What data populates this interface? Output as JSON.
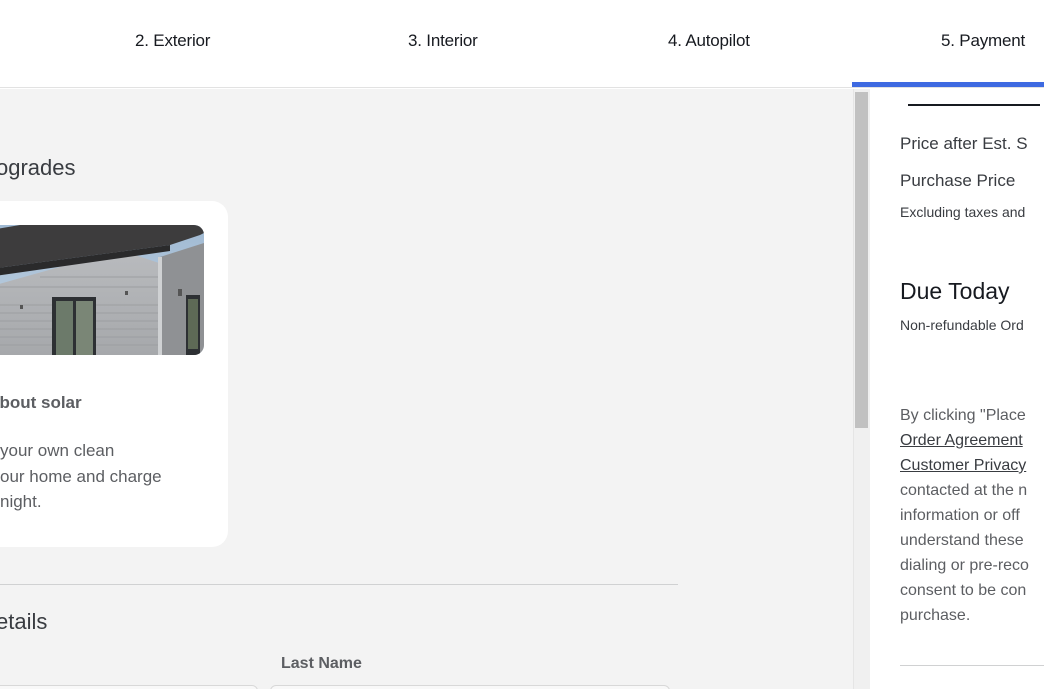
{
  "nav": {
    "steps": [
      {
        "label": "2. Exterior"
      },
      {
        "label": "3. Interior"
      },
      {
        "label": "4. Autopilot"
      },
      {
        "label": "5. Payment",
        "active": true
      }
    ],
    "accent_color": "#3e6ae1"
  },
  "main": {
    "upgrades_heading": "ograde",
    "upgrades_heading_full": "ogrades",
    "solar_card": {
      "image": "house-with-solar-roof",
      "title": "about solar",
      "description_lines": [
        "your own clean",
        "our home and charge",
        "night."
      ]
    },
    "details_heading": "etails",
    "last_name_label": "Last Name"
  },
  "summary": {
    "price_after": "Price after Est. S",
    "purchase_price": "Purchase Price",
    "excluding": "Excluding taxes and",
    "due_today": "Due Today",
    "non_refundable": "Non-refundable Ord",
    "legal": {
      "line1": "By clicking \"Place",
      "link1": "Order Agreement",
      "link2": "Customer Privacy",
      "line4": "contacted at the n",
      "line5": "information or off",
      "line6": "understand these",
      "line7": "dialing or pre-reco",
      "line8": "consent to be con",
      "line9": "purchase."
    }
  }
}
